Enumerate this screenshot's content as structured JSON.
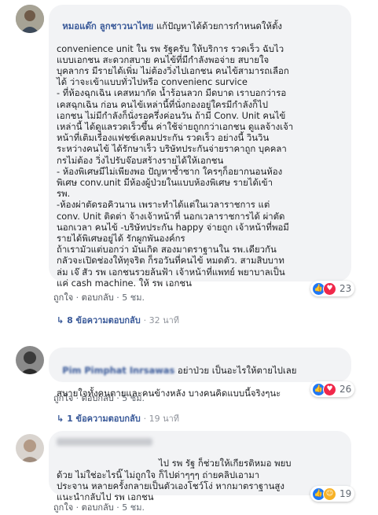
{
  "comments": [
    {
      "author": "หมอแด๊ก ลูกชาวนาไทย",
      "lines": [
        "หมอแด๊ก ลูกชาวนาไทย แก้ปัญหาได้ด้วยการกำหนดให้ตั้ง",
        "convenience unit ใน รพ รัฐครับ ให้บริการ รวดเร็ว ฉับไว",
        "แบบเอกชน สะดวกสบาย คนไข้ที่มีกำลังพอจ่าย สบายใจ",
        "บุคลากร มีรายได้เพิ่ม ไม่ต้องวิ่งไปเอกชน คนไข้สามารถเลือก",
        "ได้ ว่าจะเข้าแบบทั่วไปหรือ convenienc survice",
        "- ที่ห้องฉุกเฉิน เคสหมากัด น้ำร้อนลวก มีดบาด เราบอกว่ารอ",
        "เคสฉุกเฉิน ก่อน คนไข้เหล่านี้ที่นั่งกองอยู่ใครมีกำลังก็ไป",
        "เอกชน ไม่มีกำลังก็นั่งรอครึ่งค่อนวัน ถ้ามี Conv. Unit คนไข้",
        "เหล่านี้ ได้ดูแลรวดเร็วขึ้น ค่าใช้จ่ายถูกกว่าเอกชน ดูแลจ้างเจ้า",
        "หน้าที่เติมเรื่องแฟชช์เคลมประกัน รวดเร็ว อย่างนี้ วินวิน",
        "ระหว่างคนไข้ ได้รักษาเร็ว บริษัทประกันจ่ายราคาถูก บุคคลา",
        "กรไม่ต้อง วิ่งไปรับจ๊อบสร้างรายได้ให้เอกชน",
        "- ห้องพิเศษมีไม่เพียงพอ ปัญหาซ้ำซาก ใครๆก็อยากนอนห้อง",
        "พิเศษ conv.unit มีห้องผู้ป่วยในแบบห้องพิเศษ รายได้เข้า",
        "รพ.",
        "-ห้องผ่าตัดรอคิวนาน เพราะทำได้แต่ในเวลาราชการ แต่",
        "conv. Unit ติดต่า จ้างเจ้าหน้าที่ นอกเวลาราชการได้ ผ่าตัด",
        "นอกเวลา คนไข้ -บริษัทประกัน happy จ่ายถูก เจ้าหน้าที่พอมี",
        "รายได้พิเศษอยู่ได้ รักผูกพันองค์กร",
        "ถ้าเรามัวแต่บอกว่า มันเกิด สองมาตราฐานใน รพ.เดียวกัน",
        "กลัวจะเปิดช่องให้ทุจริต ก็รอวันที่คนไข้ หมดตัว. สามสิบบาท",
        "ล่ม เจ๊ สัว รพ เอกชนรวยล้นฟ้า เจ้าหน้าที่แพทย์ พยาบาลเป็น",
        "แค่ cash machine. ให้ รพ เอกชน"
      ],
      "actions": {
        "like": "ถูกใจ",
        "reply": "ตอบกลับ",
        "time": "5 ชม."
      },
      "reactions": {
        "count": "23",
        "icons": [
          "like-icon",
          "love-icon"
        ]
      },
      "replies": {
        "label": "8 ข้อความตอบกลับ",
        "time": "32 นาที"
      }
    },
    {
      "author": "Pim Pimphat Inrsawas",
      "lines": [
        "Pim Pimphat Inrsawas อย่าป่วย เป็นอะไรให้ตายไปเลย",
        "สบายใจทั้งคนตายและคนข้างหลัง บางคนคิดแบบนี้จริงๆนะ"
      ],
      "actions": {
        "like": "ถูกใจ",
        "reply": "ตอบกลับ",
        "time": "5 ชม."
      },
      "reactions": {
        "count": "26",
        "icons": [
          "like-icon",
          "love-icon"
        ]
      },
      "replies": {
        "label": "1 ข้อความตอบกลับ",
        "time": "19 นาที"
      }
    },
    {
      "author": "",
      "lines": [
        "ไป รพ รัฐ ก็ช่วยให้เกียรติหมอ พยบ",
        "ด้วย ไม่ใช่อะไรนิ๊ ไม่ถูกใจ ก็ไปด่าๆๆๆ ถ่ายคลิปเอามา",
        "ประจาน หลายครั้งกลายเป็นตัวเองโชว์โง่ หากมาตราฐานสูง",
        "แนะนำกลับไป รพ เอกชน"
      ],
      "actions": {
        "like": "ถูกใจ",
        "reply": "ตอบกลับ",
        "time": "5 ชม."
      },
      "reactions": {
        "count": "19",
        "icons": [
          "like-icon",
          "haha-icon"
        ]
      }
    }
  ],
  "colors": {
    "link": "#385898",
    "bubble": "#f2f3f5",
    "like": "#2078f4",
    "love": "#f0284a",
    "haha": "#f7b125"
  }
}
